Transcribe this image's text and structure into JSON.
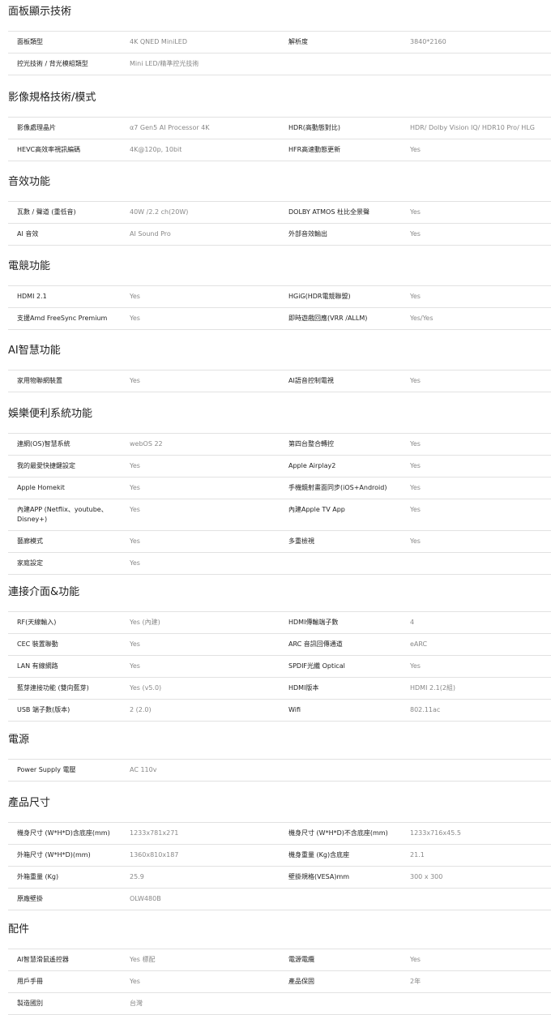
{
  "sections": [
    {
      "title": "面板顯示技術",
      "rows": [
        [
          "面板類型",
          "4K QNED MiniLED",
          "解析度",
          "3840*2160"
        ],
        [
          "控光技術 / 背光模組類型",
          "Mini LED/精準控光技術",
          "",
          ""
        ]
      ]
    },
    {
      "title": "影像規格技術/模式",
      "rows": [
        [
          "影像處理晶片",
          "α7 Gen5 AI Processor 4K",
          "HDR(高動態對比)",
          "HDR/ Dolby Vision IQ/ HDR10 Pro/ HLG"
        ],
        [
          "HEVC高效率視訊編碼",
          "4K@120p, 10bit",
          "HFR高速動態更新",
          "Yes"
        ]
      ]
    },
    {
      "title": "音效功能",
      "rows": [
        [
          "瓦數 / 聲道 (重低音)",
          "40W /2.2 ch(20W)",
          "DOLBY ATMOS 杜比全景聲",
          "Yes"
        ],
        [
          "AI 音效",
          "AI Sound Pro",
          "外部音效輸出",
          "Yes"
        ]
      ]
    },
    {
      "title": "電競功能",
      "rows": [
        [
          "HDMI 2.1",
          "Yes",
          "HGiG(HDR電競聯盟)",
          "Yes"
        ],
        [
          "支援Amd FreeSync Premium",
          "Yes",
          "即時遊戲回應(VRR /ALLM)",
          "Yes/Yes"
        ]
      ]
    },
    {
      "title": "AI智慧功能",
      "rows": [
        [
          "家用物聯網裝置",
          "Yes",
          "AI語音控制電視",
          "Yes"
        ]
      ]
    },
    {
      "title": "娛樂便利系統功能",
      "rows": [
        [
          "連網(OS)智慧系統",
          "webOS 22",
          "第四台整合轉控",
          "Yes"
        ],
        [
          "我的最愛快捷鍵設定",
          "Yes",
          "Apple Airplay2",
          "Yes"
        ],
        [
          "Apple Homekit",
          "Yes",
          "手機鏡射畫面同步(iOS+Android)",
          "Yes"
        ],
        [
          "內建APP (Netflix、youtube、Disney+)",
          "Yes",
          "內建Apple TV App",
          "Yes"
        ],
        [
          "藝廊模式",
          "Yes",
          "多重檢視",
          "Yes"
        ],
        [
          "家庭設定",
          "Yes",
          "",
          ""
        ]
      ]
    },
    {
      "title": "連接介面&功能",
      "rows": [
        [
          "RF(天線輸入)",
          "Yes (內建)",
          "HDMI傳輸端子數",
          "4"
        ],
        [
          "CEC 裝置聯動",
          "Yes",
          "ARC 音訊回傳通道",
          "eARC"
        ],
        [
          "LAN 有線網路",
          "Yes",
          "SPDIF光纖 Optical",
          "Yes"
        ],
        [
          "藍芽連接功能 (雙向藍芽)",
          "Yes (v5.0)",
          "HDMI版本",
          "HDMI 2.1(2組)"
        ],
        [
          "USB 端子數(版本)",
          "2 (2.0)",
          "Wifi",
          "802.11ac"
        ]
      ]
    },
    {
      "title": "電源",
      "rows": [
        [
          "Power Supply 電壓",
          "AC 110v",
          "",
          ""
        ]
      ]
    },
    {
      "title": "產品尺寸",
      "rows": [
        [
          "機身尺寸 (W*H*D)含底座(mm)",
          "1233x781x271",
          "機身尺寸 (W*H*D)不含底座(mm)",
          "1233x716x45.5"
        ],
        [
          "外箱尺寸 (W*H*D)(mm)",
          "1360x810x187",
          "機身重量 (Kg)含底座",
          "21.1"
        ],
        [
          "外箱重量 (Kg)",
          "25.9",
          "壁掛規格(VESA)mm",
          "300 x 300"
        ],
        [
          "原廠壁掛",
          "OLW480B",
          "",
          ""
        ]
      ]
    },
    {
      "title": "配件",
      "rows": [
        [
          "AI智慧滑鼠遙控器",
          "Yes 標配",
          "電源電纜",
          "Yes"
        ],
        [
          "用戶手冊",
          "Yes",
          "產品保固",
          "2年"
        ],
        [
          "製造國別",
          "台灣",
          "",
          ""
        ]
      ]
    }
  ]
}
